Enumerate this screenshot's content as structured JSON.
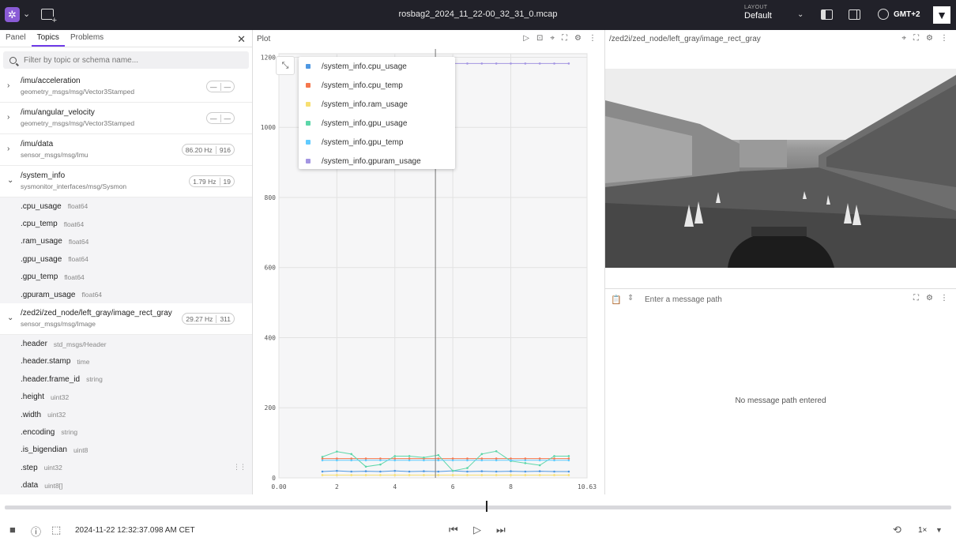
{
  "topbar": {
    "file_name": "rosbag2_2024_11_22-00_32_31_0.mcap",
    "layout_label": "LAYOUT",
    "layout_value": "Default",
    "timezone": "GMT+2"
  },
  "sidebar": {
    "tabs": [
      "Panel",
      "Topics",
      "Problems"
    ],
    "active_tab": "Topics",
    "filter_placeholder": "Filter by topic or schema name...",
    "topics": [
      {
        "name": "/imu/acceleration",
        "schema": "geometry_msgs/msg/Vector3Stamped",
        "rate": "—",
        "count": "—",
        "expanded": false
      },
      {
        "name": "/imu/angular_velocity",
        "schema": "geometry_msgs/msg/Vector3Stamped",
        "rate": "—",
        "count": "—",
        "expanded": false
      },
      {
        "name": "/imu/data",
        "schema": "sensor_msgs/msg/Imu",
        "rate": "86.20 Hz",
        "count": "916",
        "expanded": false
      },
      {
        "name": "/system_info",
        "schema": "sysmonitor_interfaces/msg/Sysmon",
        "rate": "1.79 Hz",
        "count": "19",
        "expanded": true,
        "fields": [
          {
            "name": ".cpu_usage",
            "type": "float64"
          },
          {
            "name": ".cpu_temp",
            "type": "float64"
          },
          {
            "name": ".ram_usage",
            "type": "float64"
          },
          {
            "name": ".gpu_usage",
            "type": "float64"
          },
          {
            "name": ".gpu_temp",
            "type": "float64"
          },
          {
            "name": ".gpuram_usage",
            "type": "float64"
          }
        ]
      },
      {
        "name": "/zed2i/zed_node/left_gray/image_rect_gray",
        "schema": "sensor_msgs/msg/Image",
        "rate": "29.27 Hz",
        "count": "311",
        "expanded": true,
        "fields": [
          {
            "name": ".header",
            "type": "std_msgs/Header"
          },
          {
            "name": ".header.stamp",
            "type": "time"
          },
          {
            "name": ".header.frame_id",
            "type": "string"
          },
          {
            "name": ".height",
            "type": "uint32"
          },
          {
            "name": ".width",
            "type": "uint32"
          },
          {
            "name": ".encoding",
            "type": "string"
          },
          {
            "name": ".is_bigendian",
            "type": "uint8"
          },
          {
            "name": ".step",
            "type": "uint32"
          },
          {
            "name": ".data",
            "type": "uint8[]"
          }
        ]
      }
    ]
  },
  "plot_panel": {
    "title": "Plot",
    "legend": [
      {
        "label": "/system_info.cpu_usage",
        "color": "#4e98e2"
      },
      {
        "label": "/system_info.cpu_temp",
        "color": "#f5774d"
      },
      {
        "label": "/system_info.ram_usage",
        "color": "#f7df71"
      },
      {
        "label": "/system_info.gpu_usage",
        "color": "#5cd6a9"
      },
      {
        "label": "/system_info.gpu_temp",
        "color": "#61cbff"
      },
      {
        "label": "/system_info.gpuram_usage",
        "color": "#a395e2"
      }
    ]
  },
  "chart_data": {
    "type": "line",
    "x_ticks": [
      "0.00",
      "2",
      "4",
      "6",
      "8",
      "10.63"
    ],
    "y_ticks": [
      "0",
      "200",
      "400",
      "600",
      "800",
      "1000",
      "1200"
    ],
    "xlim": [
      0,
      10.63
    ],
    "ylim": [
      0,
      1210
    ],
    "cursor_x": 5.4,
    "x": [
      1.5,
      2.0,
      2.5,
      3.0,
      3.5,
      4.0,
      4.5,
      5.0,
      5.5,
      6.0,
      6.5,
      7.0,
      7.5,
      8.0,
      8.5,
      9.0,
      9.5,
      10.0
    ],
    "series": [
      {
        "name": "/system_info.cpu_usage",
        "color": "#4e98e2",
        "values": [
          18,
          20,
          18,
          19,
          18,
          20,
          18,
          19,
          18,
          20,
          18,
          19,
          18,
          19,
          18,
          19,
          18,
          18
        ]
      },
      {
        "name": "/system_info.cpu_temp",
        "color": "#f5774d",
        "values": [
          55,
          55,
          55,
          55,
          55,
          55,
          55,
          55,
          55,
          55,
          55,
          55,
          55,
          55,
          55,
          55,
          55,
          55
        ]
      },
      {
        "name": "/system_info.ram_usage",
        "color": "#f7df71",
        "values": [
          8,
          8,
          8,
          8,
          8,
          8,
          8,
          8,
          8,
          8,
          8,
          8,
          8,
          8,
          8,
          8,
          8,
          8
        ]
      },
      {
        "name": "/system_info.gpu_usage",
        "color": "#5cd6a9",
        "values": [
          60,
          75,
          68,
          32,
          38,
          62,
          62,
          58,
          65,
          20,
          28,
          68,
          76,
          48,
          42,
          36,
          62,
          62
        ]
      },
      {
        "name": "/system_info.gpu_temp",
        "color": "#61cbff",
        "values": [
          50,
          50,
          50,
          50,
          50,
          50,
          50,
          50,
          50,
          50,
          50,
          50,
          50,
          50,
          50,
          50,
          50,
          50
        ]
      },
      {
        "name": "/system_info.gpuram_usage",
        "color": "#a395e2",
        "values": [
          1182,
          1182,
          1182,
          1182,
          1182,
          1182,
          1182,
          1182,
          1182,
          1182,
          1182,
          1182,
          1182,
          1182,
          1182,
          1182,
          1182,
          1182
        ]
      }
    ]
  },
  "image_panel": {
    "title": "/zed2i/zed_node/left_gray/image_rect_gray"
  },
  "raw_panel": {
    "placeholder": "Enter a message path",
    "empty_text": "No message path entered"
  },
  "playback": {
    "timestamp": "2024-11-22 12:32:37.098 AM CET",
    "progress": 0.508,
    "speed": "1×"
  }
}
